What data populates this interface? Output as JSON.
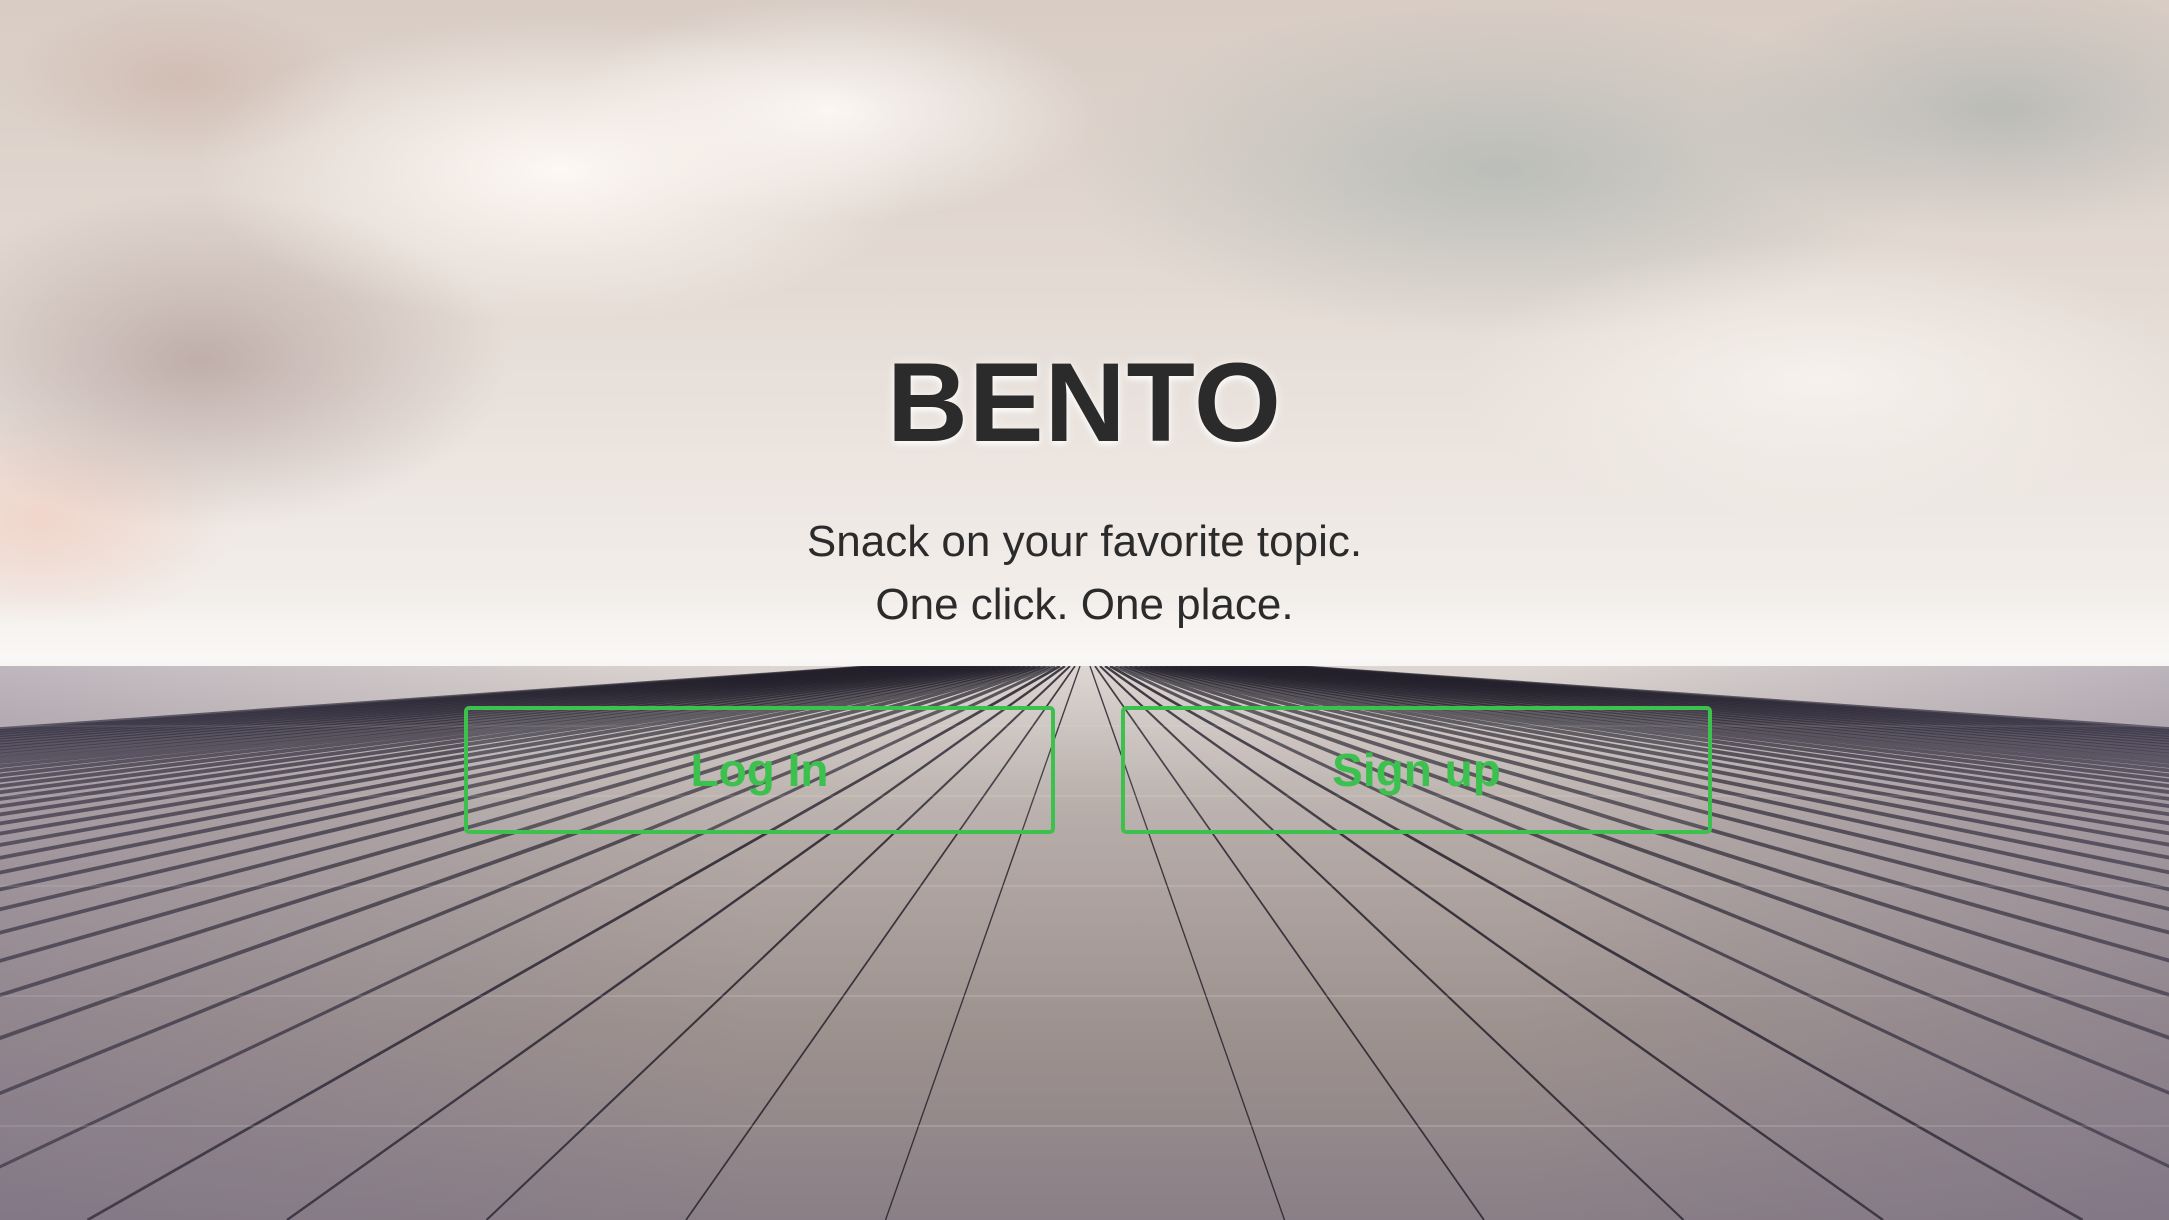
{
  "hero": {
    "title": "BENTO",
    "tagline_line1": "Snack on your favorite topic.",
    "tagline_line2": "One click. One place."
  },
  "actions": {
    "login_label": "Log In",
    "signup_label": "Sign up"
  },
  "colors": {
    "accent": "#3cc14f",
    "text": "#2b2b2b"
  }
}
